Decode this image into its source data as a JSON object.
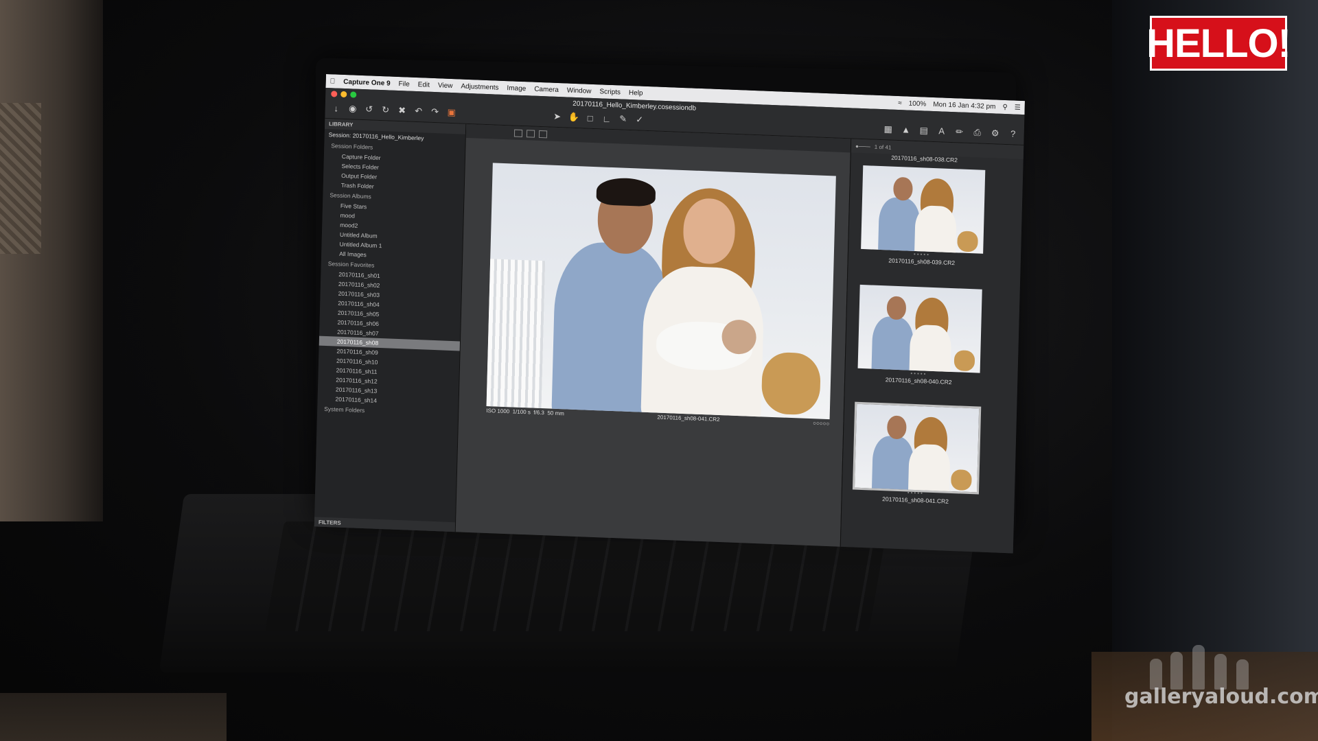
{
  "menubar": {
    "app_name": "Capture One 9",
    "items": [
      "File",
      "Edit",
      "View",
      "Adjustments",
      "Image",
      "Camera",
      "Window",
      "Scripts",
      "Help"
    ],
    "status": {
      "battery": "100%",
      "datetime": "Mon 16 Jan  4:32 pm"
    }
  },
  "toolbar": {
    "session_title": "20170116_Hello_Kimberley.cosessiondb"
  },
  "library": {
    "header": "LIBRARY",
    "session": "Session: 20170116_Hello_Kimberley",
    "session_folders_label": "Session Folders",
    "session_folders": [
      "Capture Folder",
      "Selects Folder",
      "Output Folder",
      "Trash Folder"
    ],
    "session_albums_label": "Session Albums",
    "session_albums": [
      "Five Stars",
      "mood",
      "mood2",
      "Untitled Album",
      "Untitled Album 1",
      "All Images"
    ],
    "session_favorites_label": "Session Favorites",
    "favorites": [
      "20170116_sh01",
      "20170116_sh02",
      "20170116_sh03",
      "20170116_sh04",
      "20170116_sh05",
      "20170116_sh06",
      "20170116_sh07",
      "20170116_sh08",
      "20170116_sh09",
      "20170116_sh10",
      "20170116_sh11",
      "20170116_sh12",
      "20170116_sh13",
      "20170116_sh14"
    ],
    "selected_index": 7,
    "system_folders_label": "System Folders",
    "filters_label": "FILTERS"
  },
  "viewer": {
    "exif": [
      "ISO 1000",
      "1/100 s",
      "f/6.3",
      "50 mm"
    ],
    "filename": "20170116_sh08-041.CR2"
  },
  "filmstrip": {
    "count": "1 of 41",
    "top_name": "20170116_sh08-038.CR2",
    "thumbs": [
      {
        "name": "20170116_sh08-039.CR2",
        "selected": false
      },
      {
        "name": "20170116_sh08-040.CR2",
        "selected": false
      },
      {
        "name": "20170116_sh08-041.CR2",
        "selected": true
      }
    ]
  },
  "overlay": {
    "logo": "HELLO!",
    "watermark": "galleryaloud.com"
  },
  "colors": {
    "hello_red": "#d6101a",
    "panel_dark": "#232426",
    "selection": "#7a7b7e"
  }
}
